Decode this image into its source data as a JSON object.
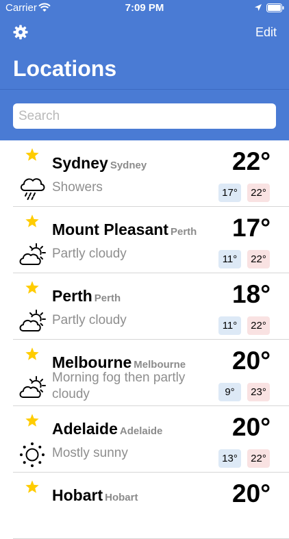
{
  "status_bar": {
    "carrier": "Carrier",
    "time": "7:09 PM"
  },
  "header": {
    "title": "Locations",
    "edit_label": "Edit",
    "search_placeholder": "Search",
    "background_color": "#4a7bd4"
  },
  "locations": [
    {
      "city": "Sydney",
      "region": "Sydney",
      "condition": "Showers",
      "icon": "rain-cloud-icon",
      "temp": "22°",
      "min": "17°",
      "max": "22°",
      "favorite": true
    },
    {
      "city": "Mount Pleasant",
      "region": "Perth",
      "condition": "Partly cloudy",
      "icon": "partly-cloudy-icon",
      "temp": "17°",
      "min": "11°",
      "max": "22°",
      "favorite": true
    },
    {
      "city": "Perth",
      "region": "Perth",
      "condition": "Partly cloudy",
      "icon": "partly-cloudy-icon",
      "temp": "18°",
      "min": "11°",
      "max": "22°",
      "favorite": true
    },
    {
      "city": "Melbourne",
      "region": "Melbourne",
      "condition": "Morning fog then partly cloudy",
      "icon": "partly-cloudy-icon",
      "temp": "20°",
      "min": "9°",
      "max": "23°",
      "favorite": true
    },
    {
      "city": "Adelaide",
      "region": "Adelaide",
      "condition": "Mostly sunny",
      "icon": "sun-icon",
      "temp": "20°",
      "min": "13°",
      "max": "22°",
      "favorite": true
    },
    {
      "city": "Hobart",
      "region": "Hobart",
      "condition": "",
      "icon": "",
      "temp": "20°",
      "min": "",
      "max": "",
      "favorite": true
    }
  ],
  "colors": {
    "star": "#ffcc00",
    "min_bg": "#dde9f6",
    "max_bg": "#f9e2e2"
  }
}
